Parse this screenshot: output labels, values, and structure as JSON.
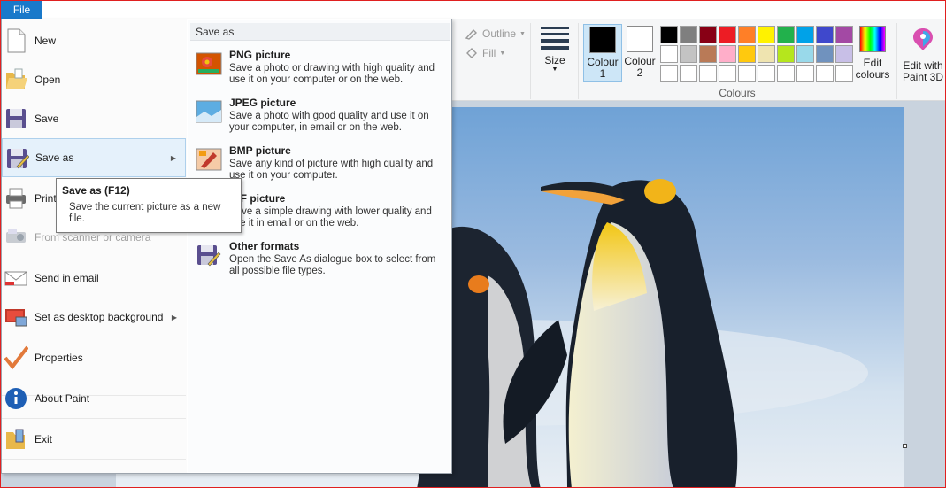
{
  "ribbon": {
    "file_tab": "File",
    "outline_label": "Outline",
    "fill_label": "Fill",
    "size_label": "Size",
    "colour1_label": "Colour 1",
    "colour2_label": "Colour 2",
    "colours_group_label": "Colours",
    "edit_colours_label": "Edit colours",
    "paint3d_label": "Edit with Paint 3D",
    "colour1_value": "#000000",
    "colour2_value": "#ffffff",
    "palette": [
      "#000000",
      "#7f7f7f",
      "#880015",
      "#ed1c24",
      "#ff7f27",
      "#fff200",
      "#22b14c",
      "#00a2e8",
      "#3f48cc",
      "#a349a4",
      "#ffffff",
      "#c3c3c3",
      "#b97a57",
      "#ffaec9",
      "#ffc90e",
      "#efe4b0",
      "#b5e61d",
      "#99d9ea",
      "#7092be",
      "#c8bfe7",
      "#ffffff",
      "#ffffff",
      "#ffffff",
      "#ffffff",
      "#ffffff",
      "#ffffff",
      "#ffffff",
      "#ffffff",
      "#ffffff",
      "#ffffff"
    ]
  },
  "file_menu": {
    "items": [
      {
        "label": "New",
        "icon": "new-document-icon"
      },
      {
        "label": "Open",
        "icon": "open-folder-icon"
      },
      {
        "label": "Save",
        "icon": "floppy-disk-icon"
      },
      {
        "label": "Save as",
        "icon": "save-as-icon"
      },
      {
        "label": "Print",
        "icon": "printer-icon"
      },
      {
        "label": "From scanner or camera",
        "icon": "scanner-icon"
      },
      {
        "label": "Send in email",
        "icon": "email-icon"
      },
      {
        "label": "Set as desktop background",
        "icon": "desktop-background-icon"
      },
      {
        "label": "Properties",
        "icon": "properties-check-icon"
      },
      {
        "label": "About Paint",
        "icon": "info-icon"
      },
      {
        "label": "Exit",
        "icon": "exit-icon"
      }
    ],
    "saveas_header": "Save as",
    "saveas_options": [
      {
        "title": "PNG picture",
        "desc": "Save a photo or drawing with high quality and use it on your computer or on the web.",
        "icon": "png-picture-icon"
      },
      {
        "title": "JPEG picture",
        "desc": "Save a photo with good quality and use it on your computer, in email or on the web.",
        "icon": "jpeg-picture-icon"
      },
      {
        "title": "BMP picture",
        "desc": "Save any kind of picture with high quality and use it on your computer.",
        "icon": "bmp-picture-icon"
      },
      {
        "title": "GIF picture",
        "desc": "Save a simple drawing with lower quality and use it in email or on the web.",
        "icon": "gif-picture-icon"
      },
      {
        "title": "Other formats",
        "desc": "Open the Save As dialogue box to select from all possible file types.",
        "icon": "other-formats-icon"
      }
    ]
  },
  "tooltip": {
    "title": "Save as (F12)",
    "desc": "Save the current picture as a new file."
  }
}
